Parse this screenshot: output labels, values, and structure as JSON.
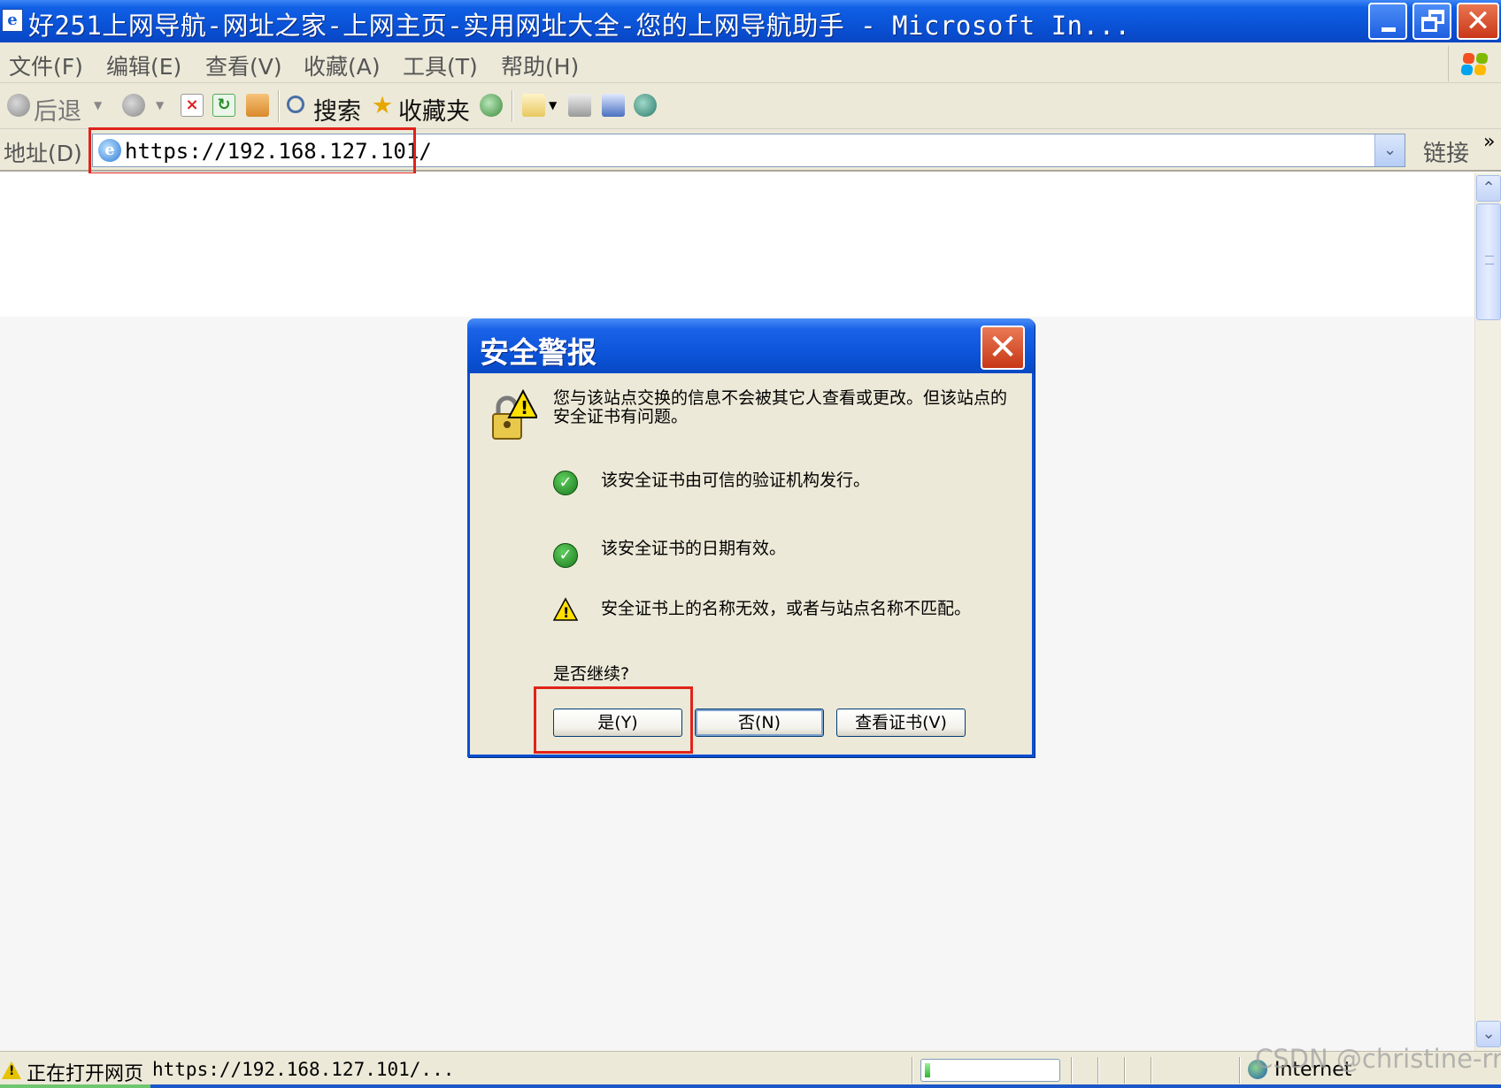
{
  "window": {
    "title": "好251上网导航-网址之家-上网主页-实用网址大全-您的上网导航助手 - Microsoft In...",
    "minimize_icon": "minimize-icon",
    "maximize_icon": "restore-icon",
    "close_icon": "close-icon"
  },
  "menu": {
    "items": [
      "文件(F)",
      "编辑(E)",
      "查看(V)",
      "收藏(A)",
      "工具(T)",
      "帮助(H)"
    ]
  },
  "toolbar": {
    "back_label": "后退",
    "search_label": "搜索",
    "favorites_label": "收藏夹"
  },
  "address": {
    "label": "地址(D)",
    "url": "https://192.168.127.101/",
    "links_label": "链接",
    "more": "»"
  },
  "dialog": {
    "title": "安全警报",
    "message": "您与该站点交换的信息不会被其它人查看或更改。但该站点的安全证书有问题。",
    "items": [
      {
        "icon": "check-icon",
        "text": "该安全证书由可信的验证机构发行。"
      },
      {
        "icon": "check-icon",
        "text": "该安全证书的日期有效。"
      },
      {
        "icon": "warning-icon",
        "text": "安全证书上的名称无效，或者与站点名称不匹配。"
      }
    ],
    "question": "是否继续?",
    "buttons": {
      "yes": "是(Y)",
      "no": "否(N)",
      "view_cert": "查看证书(V)"
    }
  },
  "status": {
    "text": "正在打开网页",
    "url": "https://192.168.127.101/...",
    "progress": 0.04,
    "zone": "Internet"
  },
  "watermark": "CSDN @christine-rr",
  "colors": {
    "titlebar": "#0a52d6",
    "highlight_box": "#e0231b",
    "chrome": "#ece9d8"
  }
}
